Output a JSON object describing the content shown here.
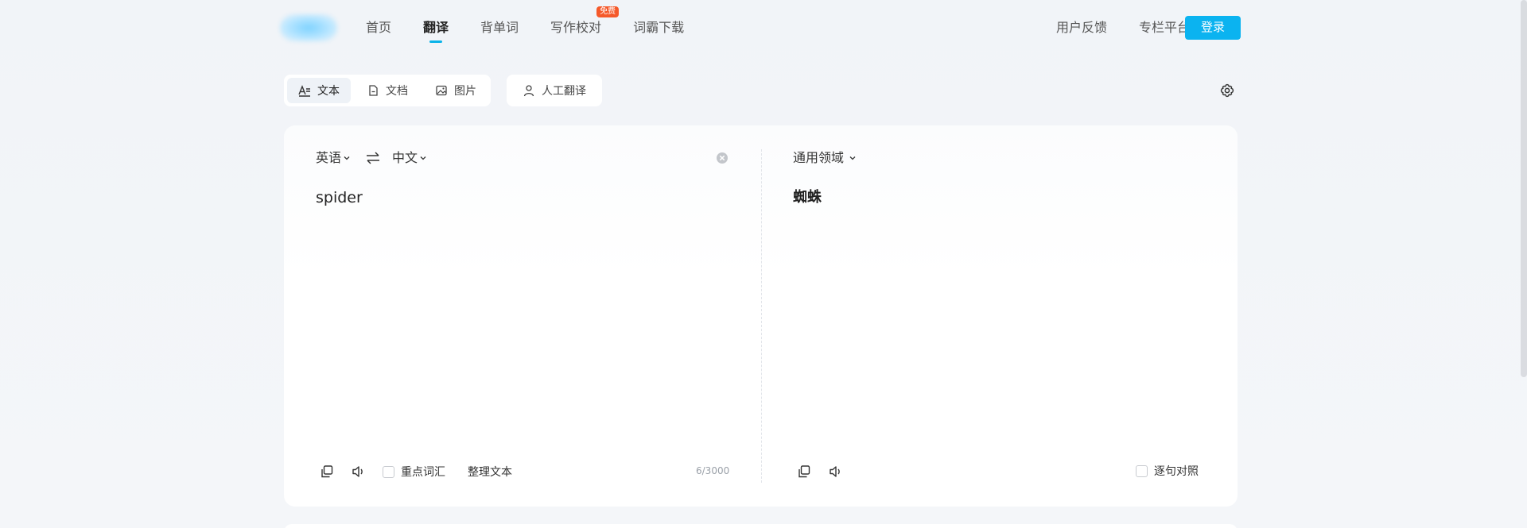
{
  "nav": {
    "items": [
      {
        "label": "首页",
        "active": false
      },
      {
        "label": "翻译",
        "active": true
      },
      {
        "label": "背单词",
        "active": false
      },
      {
        "label": "写作校对",
        "active": false,
        "badge": "免费"
      },
      {
        "label": "词霸下载",
        "active": false
      }
    ],
    "feedback": "用户反馈",
    "column": "专栏平台",
    "login": "登录"
  },
  "modes": {
    "text": "文本",
    "doc": "文档",
    "image": "图片",
    "human": "人工翻译"
  },
  "source": {
    "language": "英语",
    "target_language": "中文",
    "text": "spider",
    "counter": "6/3000",
    "key_vocab": "重点词汇",
    "tidy": "整理文本"
  },
  "target": {
    "domain": "通用领域",
    "text": "蜘蛛",
    "sentence_align": "逐句对照"
  },
  "colors": {
    "accent": "#0bb3f0",
    "badge": "#f5592a"
  },
  "icons": {
    "settings": "gear-icon",
    "swap": "swap-icon",
    "clear": "clear-icon",
    "copy": "copy-icon",
    "speaker": "speaker-icon"
  }
}
